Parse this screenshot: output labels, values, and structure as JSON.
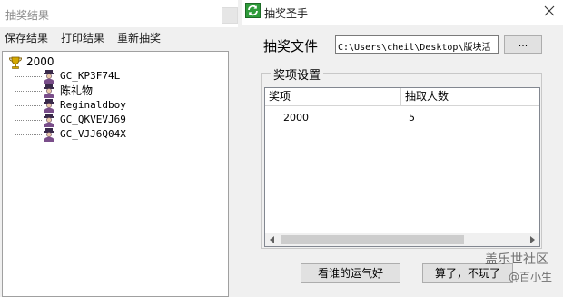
{
  "left_window": {
    "title": "抽奖结果",
    "menu": {
      "save": "保存结果",
      "print": "打印结果",
      "redraw": "重新抽奖"
    },
    "tree": {
      "root": {
        "label": "2000",
        "icon": "trophy-icon"
      },
      "winners": [
        {
          "label": "GC_KP3F74L",
          "icon": "user-icon"
        },
        {
          "label": "陈礼物",
          "icon": "user-icon"
        },
        {
          "label": "Reginaldboy",
          "icon": "user-icon"
        },
        {
          "label": "GC_QKVEVJ69",
          "icon": "user-icon"
        },
        {
          "label": "GC_VJJ6Q04X",
          "icon": "user-icon"
        }
      ]
    }
  },
  "right_window": {
    "title": "抽奖圣手",
    "app_icon": "refresh-icon",
    "file": {
      "label": "抽奖文件",
      "value": "C:\\Users\\cheil\\Desktop\\版块活",
      "browse_label": "..."
    },
    "prizes": {
      "group_title": "奖项设置",
      "columns": [
        "奖项",
        "抽取人数"
      ],
      "rows": [
        {
          "prize": "2000",
          "count": "5"
        }
      ]
    },
    "buttons": {
      "luck": "看谁的运气好",
      "quit": "算了，不玩了"
    }
  },
  "watermark": {
    "main": "盖乐世社区",
    "sub": "@百小生"
  },
  "colors": {
    "window_bg": "#f0f0f0",
    "titlebar": "#ffffff",
    "app_icon_green": "#2e9b3a",
    "trophy_gold": "#c8a000",
    "user_icon_purple": "#7a4e8a"
  }
}
